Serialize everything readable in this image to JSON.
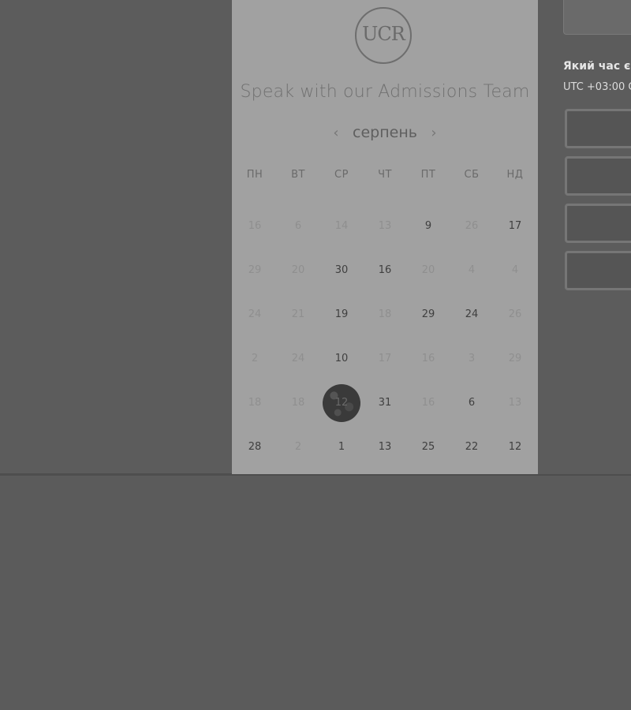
{
  "card": {
    "logo_text": "UCR",
    "title": "Speak with our Admissions Team",
    "month": "серпень",
    "prev_month_icon": "chevron-left-icon",
    "next_month_icon": "chevron-right-icon"
  },
  "weekdays": [
    "ПН",
    "ВТ",
    "СР",
    "ЧТ",
    "ПТ",
    "СБ",
    "НД"
  ],
  "calendar": {
    "weeks": [
      [
        {
          "label": "16",
          "available": false
        },
        {
          "label": "6",
          "available": false
        },
        {
          "label": "14",
          "available": false
        },
        {
          "label": "13",
          "available": false
        },
        {
          "label": "9",
          "available": true
        },
        {
          "label": "26",
          "available": false
        },
        {
          "label": "17",
          "available": true
        }
      ],
      [
        {
          "label": "29",
          "available": false
        },
        {
          "label": "20",
          "available": false
        },
        {
          "label": "30",
          "available": true
        },
        {
          "label": "16",
          "available": true
        },
        {
          "label": "20",
          "available": false
        },
        {
          "label": "4",
          "available": false
        },
        {
          "label": "4",
          "available": false
        }
      ],
      [
        {
          "label": "24",
          "available": false
        },
        {
          "label": "21",
          "available": false
        },
        {
          "label": "19",
          "available": true
        },
        {
          "label": "18",
          "available": false
        },
        {
          "label": "29",
          "available": true
        },
        {
          "label": "24",
          "available": true
        },
        {
          "label": "26",
          "available": false
        }
      ],
      [
        {
          "label": "2",
          "available": false
        },
        {
          "label": "24",
          "available": false
        },
        {
          "label": "10",
          "available": true
        },
        {
          "label": "17",
          "available": false
        },
        {
          "label": "16",
          "available": false
        },
        {
          "label": "3",
          "available": false
        },
        {
          "label": "29",
          "available": false
        }
      ],
      [
        {
          "label": "18",
          "available": false
        },
        {
          "label": "18",
          "available": false
        },
        {
          "label": "12",
          "available": true,
          "selected": true
        },
        {
          "label": "31",
          "available": true
        },
        {
          "label": "16",
          "available": false
        },
        {
          "label": "6",
          "available": true
        },
        {
          "label": "13",
          "available": false
        }
      ],
      [
        {
          "label": "28",
          "available": true
        },
        {
          "label": "2",
          "available": false
        },
        {
          "label": "1",
          "available": true
        },
        {
          "label": "13",
          "available": true
        },
        {
          "label": "25",
          "available": true
        },
        {
          "label": "22",
          "available": true
        },
        {
          "label": "12",
          "available": true
        }
      ]
    ]
  },
  "timezone": {
    "question": "Який час є",
    "value": "UTC +03:00 С"
  },
  "time_slots": [
    "",
    "",
    "",
    ""
  ]
}
